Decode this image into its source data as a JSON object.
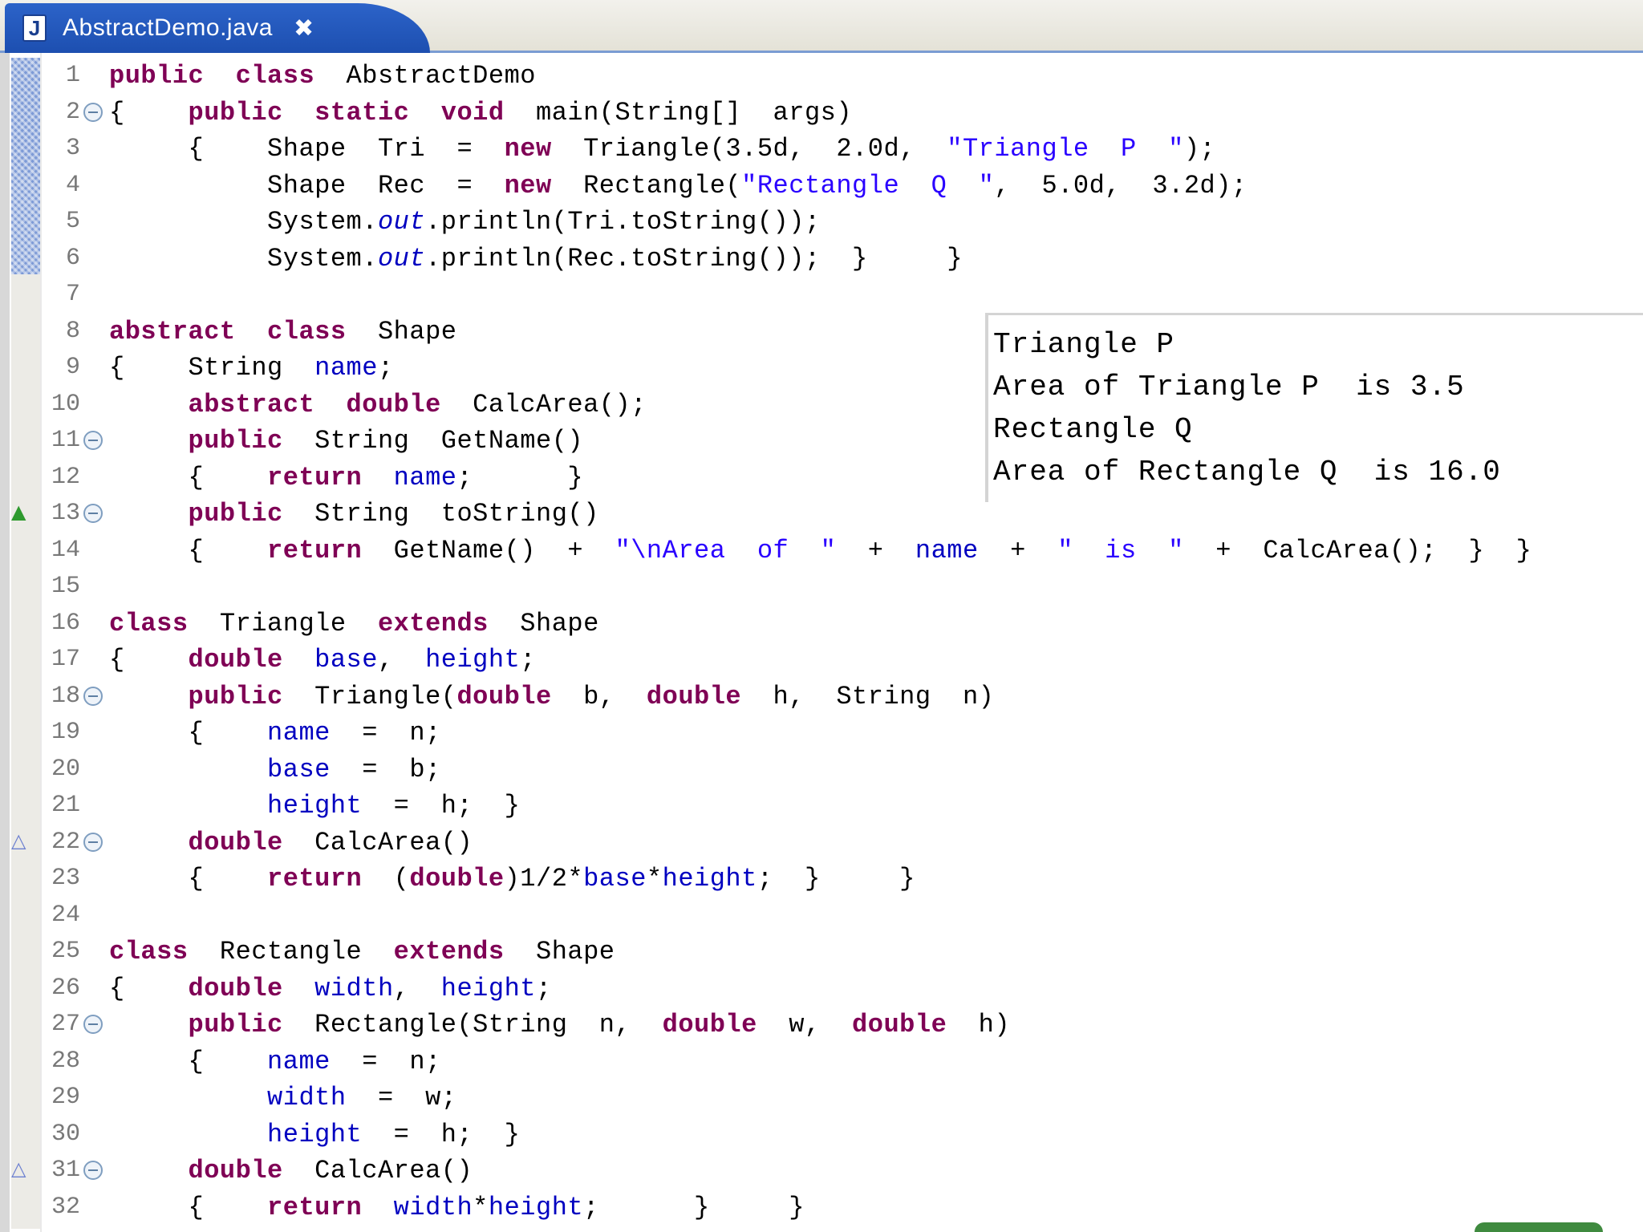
{
  "tab": {
    "label": "AbstractDemo.java",
    "icon": "java-file-icon",
    "icon_glyph": "J",
    "close_glyph": "✖"
  },
  "lines": [
    {
      "n": "1",
      "tokens": [
        [
          "kw",
          "public"
        ],
        [
          "",
          "  "
        ],
        [
          "kw",
          "class"
        ],
        [
          "",
          "  AbstractDemo"
        ]
      ]
    },
    {
      "n": "2",
      "fold": true,
      "tokens": [
        [
          "",
          "{    "
        ],
        [
          "kw",
          "public"
        ],
        [
          "",
          "  "
        ],
        [
          "kw",
          "static"
        ],
        [
          "",
          "  "
        ],
        [
          "kw",
          "void"
        ],
        [
          "",
          "  main(String[]  args)"
        ]
      ]
    },
    {
      "n": "3",
      "tokens": [
        [
          "",
          "     {    Shape  Tri  =  "
        ],
        [
          "kw",
          "new"
        ],
        [
          "",
          "  Triangle(3.5d,  2.0d,  "
        ],
        [
          "str",
          "\"Triangle  P  \""
        ],
        [
          "",
          ");"
        ]
      ]
    },
    {
      "n": "4",
      "tokens": [
        [
          "",
          "          Shape  Rec  =  "
        ],
        [
          "kw",
          "new"
        ],
        [
          "",
          "  Rectangle("
        ],
        [
          "str",
          "\"Rectangle  Q  \""
        ],
        [
          "",
          ",  5.0d,  3.2d);"
        ]
      ]
    },
    {
      "n": "5",
      "tokens": [
        [
          "",
          "          System."
        ],
        [
          "sfld",
          "out"
        ],
        [
          "",
          ".println(Tri.toString());"
        ]
      ]
    },
    {
      "n": "6",
      "tokens": [
        [
          "",
          "          System."
        ],
        [
          "sfld",
          "out"
        ],
        [
          "",
          ".println(Rec.toString());  }     }"
        ]
      ]
    },
    {
      "n": "7",
      "tokens": []
    },
    {
      "n": "8",
      "tokens": [
        [
          "kw",
          "abstract"
        ],
        [
          "",
          "  "
        ],
        [
          "kw",
          "class"
        ],
        [
          "",
          "  Shape"
        ]
      ]
    },
    {
      "n": "9",
      "tokens": [
        [
          "",
          "{    String  "
        ],
        [
          "fld",
          "name"
        ],
        [
          "",
          ";"
        ]
      ]
    },
    {
      "n": "10",
      "tokens": [
        [
          "",
          "     "
        ],
        [
          "kw",
          "abstract"
        ],
        [
          "",
          "  "
        ],
        [
          "kw",
          "double"
        ],
        [
          "",
          "  CalcArea();"
        ]
      ]
    },
    {
      "n": "11",
      "fold": true,
      "tokens": [
        [
          "",
          "     "
        ],
        [
          "kw",
          "public"
        ],
        [
          "",
          "  String  GetName()"
        ]
      ]
    },
    {
      "n": "12",
      "tokens": [
        [
          "",
          "     {    "
        ],
        [
          "kw",
          "return"
        ],
        [
          "",
          "  "
        ],
        [
          "fld",
          "name"
        ],
        [
          "",
          ";      }"
        ]
      ]
    },
    {
      "n": "13",
      "fold": true,
      "ann": "green",
      "tokens": [
        [
          "",
          "     "
        ],
        [
          "kw",
          "public"
        ],
        [
          "",
          "  String  toString()"
        ]
      ]
    },
    {
      "n": "14",
      "tokens": [
        [
          "",
          "     {    "
        ],
        [
          "kw",
          "return"
        ],
        [
          "",
          "  GetName()  +  "
        ],
        [
          "str",
          "\"\\nArea  of  \""
        ],
        [
          "",
          "  +  "
        ],
        [
          "fld",
          "name"
        ],
        [
          "",
          "  +  "
        ],
        [
          "str",
          "\"  is  \""
        ],
        [
          "",
          "  +  CalcArea();  }  }"
        ]
      ]
    },
    {
      "n": "15",
      "tokens": []
    },
    {
      "n": "16",
      "tokens": [
        [
          "kw",
          "class"
        ],
        [
          "",
          "  Triangle  "
        ],
        [
          "kw",
          "extends"
        ],
        [
          "",
          "  Shape"
        ]
      ]
    },
    {
      "n": "17",
      "tokens": [
        [
          "",
          "{    "
        ],
        [
          "kw",
          "double"
        ],
        [
          "",
          "  "
        ],
        [
          "fld",
          "base"
        ],
        [
          "",
          ",  "
        ],
        [
          "fld",
          "height"
        ],
        [
          "",
          ";"
        ]
      ]
    },
    {
      "n": "18",
      "fold": true,
      "tokens": [
        [
          "",
          "     "
        ],
        [
          "kw",
          "public"
        ],
        [
          "",
          "  Triangle("
        ],
        [
          "kw",
          "double"
        ],
        [
          "",
          "  b,  "
        ],
        [
          "kw",
          "double"
        ],
        [
          "",
          "  h,  String  n)"
        ]
      ]
    },
    {
      "n": "19",
      "tokens": [
        [
          "",
          "     {    "
        ],
        [
          "fld",
          "name"
        ],
        [
          "",
          "  =  n;"
        ]
      ]
    },
    {
      "n": "20",
      "tokens": [
        [
          "",
          "          "
        ],
        [
          "fld",
          "base"
        ],
        [
          "",
          "  =  b;"
        ]
      ]
    },
    {
      "n": "21",
      "tokens": [
        [
          "",
          "          "
        ],
        [
          "fld",
          "height"
        ],
        [
          "",
          "  =  h;  }"
        ]
      ]
    },
    {
      "n": "22",
      "fold": true,
      "ann": "blue",
      "tokens": [
        [
          "",
          "     "
        ],
        [
          "kw",
          "double"
        ],
        [
          "",
          "  CalcArea()"
        ]
      ]
    },
    {
      "n": "23",
      "tokens": [
        [
          "",
          "     {    "
        ],
        [
          "kw",
          "return"
        ],
        [
          "",
          "  ("
        ],
        [
          "kw",
          "double"
        ],
        [
          "",
          ")1/2*"
        ],
        [
          "fld",
          "base"
        ],
        [
          "",
          "*"
        ],
        [
          "fld",
          "height"
        ],
        [
          "",
          ";  }     }"
        ]
      ]
    },
    {
      "n": "24",
      "tokens": []
    },
    {
      "n": "25",
      "tokens": [
        [
          "kw",
          "class"
        ],
        [
          "",
          "  Rectangle  "
        ],
        [
          "kw",
          "extends"
        ],
        [
          "",
          "  Shape"
        ]
      ]
    },
    {
      "n": "26",
      "tokens": [
        [
          "",
          "{    "
        ],
        [
          "kw",
          "double"
        ],
        [
          "",
          "  "
        ],
        [
          "fld",
          "width"
        ],
        [
          "",
          ",  "
        ],
        [
          "fld",
          "height"
        ],
        [
          "",
          ";"
        ]
      ]
    },
    {
      "n": "27",
      "fold": true,
      "tokens": [
        [
          "",
          "     "
        ],
        [
          "kw",
          "public"
        ],
        [
          "",
          "  Rectangle(String  n,  "
        ],
        [
          "kw",
          "double"
        ],
        [
          "",
          "  w,  "
        ],
        [
          "kw",
          "double"
        ],
        [
          "",
          "  h)"
        ]
      ]
    },
    {
      "n": "28",
      "tokens": [
        [
          "",
          "     {    "
        ],
        [
          "fld",
          "name"
        ],
        [
          "",
          "  =  n;"
        ]
      ]
    },
    {
      "n": "29",
      "tokens": [
        [
          "",
          "          "
        ],
        [
          "fld",
          "width"
        ],
        [
          "",
          "  =  w;"
        ]
      ]
    },
    {
      "n": "30",
      "tokens": [
        [
          "",
          "          "
        ],
        [
          "fld",
          "height"
        ],
        [
          "",
          "  =  h;  }"
        ]
      ]
    },
    {
      "n": "31",
      "fold": true,
      "ann": "blue",
      "tokens": [
        [
          "",
          "     "
        ],
        [
          "kw",
          "double"
        ],
        [
          "",
          "  CalcArea()"
        ]
      ]
    },
    {
      "n": "32",
      "tokens": [
        [
          "",
          "     {    "
        ],
        [
          "kw",
          "return"
        ],
        [
          "",
          "  "
        ],
        [
          "fld",
          "width"
        ],
        [
          "",
          "*"
        ],
        [
          "fld",
          "height"
        ],
        [
          "",
          ";      }     }"
        ]
      ]
    }
  ],
  "console": {
    "lines": [
      "Triangle P",
      "Area of Triangle P  is 3.5",
      "Rectangle Q",
      "Area of Rectangle Q  is 16.0"
    ]
  },
  "annotation_glyphs": {
    "green": "▲",
    "blue": "△"
  },
  "colors": {
    "keyword": "#7f0055",
    "field": "#0000c0",
    "string": "#2a00ff",
    "tab_active": "#2c63c9"
  }
}
